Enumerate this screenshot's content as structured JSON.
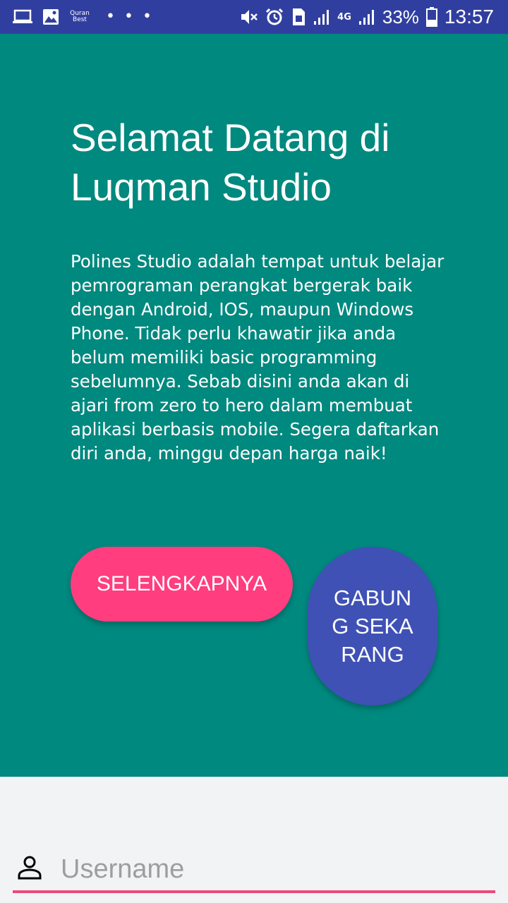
{
  "status_bar": {
    "left_icons": [
      "laptop-icon",
      "image-icon",
      "quran-best-icon",
      "more-dots-icon"
    ],
    "quran_label": "Quran Best",
    "dots": "• • •",
    "right_icons": [
      "mute-icon",
      "alarm-icon",
      "sim-icon",
      "signal-icon",
      "4g-icon",
      "signal-icon",
      "battery-icon"
    ],
    "network_label": "4G",
    "battery_percent": "33%",
    "time": "13:57",
    "background_color": "#303f9f"
  },
  "hero": {
    "background_color": "#00897f",
    "title": "Selamat Datang di Luqman Studio",
    "description": "Polines Studio adalah tempat untuk belajar pemrograman perangkat bergerak baik dengan Android, IOS, maupun Windows Phone. Tidak perlu khawatir jika anda belum memiliki basic programming sebelumnya. Sebab disini anda akan di ajari from zero to hero dalam membuat aplikasi berbasis mobile. Segera daftarkan diri anda, minggu depan harga naik!",
    "more_button": "SELENGKAPNYA",
    "join_button": "GABUNG SEKARANG"
  },
  "form": {
    "username_placeholder": "Username",
    "username_value": "",
    "accent_color": "#ea4c7a"
  }
}
